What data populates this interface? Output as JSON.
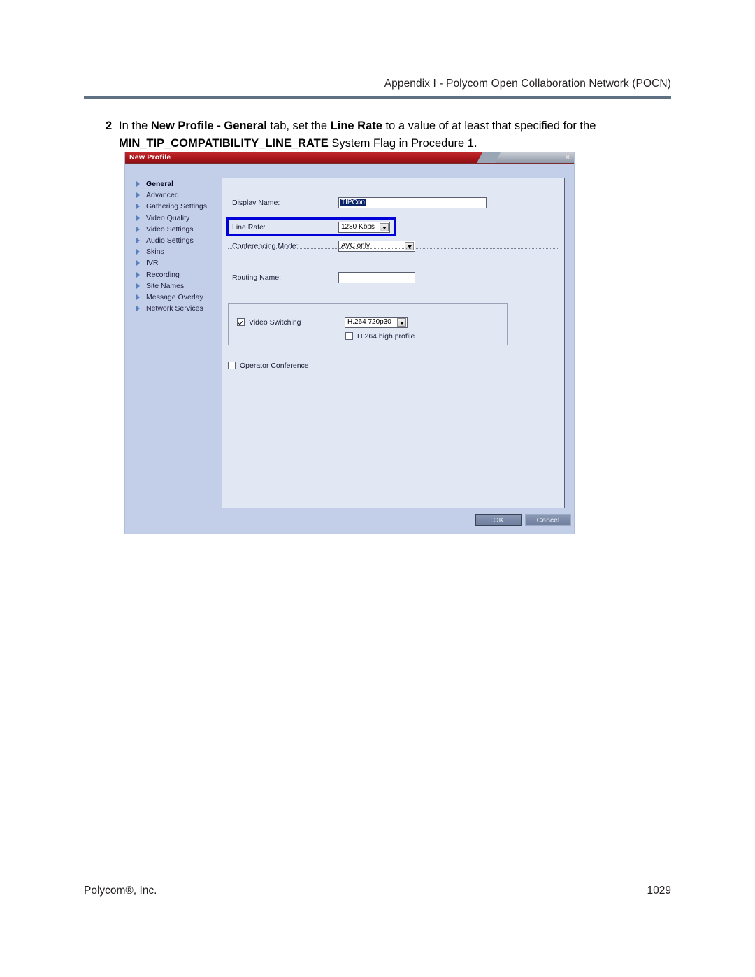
{
  "page": {
    "header": "Appendix I - Polycom Open Collaboration Network (POCN)",
    "footer_left": "Polycom®, Inc.",
    "footer_right": "1029"
  },
  "step": {
    "number": "2",
    "text_1": "In the ",
    "bold_1": "New Profile - General",
    "text_2": " tab, set the ",
    "bold_2": "Line Rate",
    "text_3": " to a value of at least that specified for the ",
    "bold_3": "MIN_TIP_COMPATIBILITY_LINE_RATE",
    "text_4": " System Flag in Procedure 1."
  },
  "dialog": {
    "title": "New Profile",
    "close_label": "×",
    "nav": [
      {
        "label": "General",
        "active": true
      },
      {
        "label": "Advanced",
        "active": false
      },
      {
        "label": "Gathering Settings",
        "active": false
      },
      {
        "label": "Video Quality",
        "active": false
      },
      {
        "label": "Video Settings",
        "active": false
      },
      {
        "label": "Audio Settings",
        "active": false
      },
      {
        "label": "Skins",
        "active": false
      },
      {
        "label": "IVR",
        "active": false
      },
      {
        "label": "Recording",
        "active": false
      },
      {
        "label": "Site Names",
        "active": false
      },
      {
        "label": "Message Overlay",
        "active": false
      },
      {
        "label": "Network Services",
        "active": false
      }
    ],
    "fields": {
      "display_name_label": "Display Name:",
      "display_name_value": "TIPCon",
      "line_rate_label": "Line Rate:",
      "line_rate_value": "1280 Kbps",
      "conferencing_mode_label": "Conferencing Mode:",
      "conferencing_mode_value": "AVC only",
      "routing_name_label": "Routing Name:",
      "routing_name_value": ""
    },
    "video_switching": {
      "checkbox_label": "Video Switching",
      "checked": true,
      "resolution_value": "H.264 720p30",
      "high_profile_label": "H.264 high profile",
      "high_profile_checked": false
    },
    "operator_conference": {
      "label": "Operator Conference",
      "checked": false
    },
    "buttons": {
      "ok": "OK",
      "cancel": "Cancel"
    }
  },
  "colors": {
    "header_rule": "#5f7183",
    "titlebar_red": "#a8161b",
    "dialog_bg": "#c3cfe8",
    "content_bg": "#e2e7f4",
    "callout_blue": "#0000d8",
    "selection_blue": "#0a246a"
  }
}
